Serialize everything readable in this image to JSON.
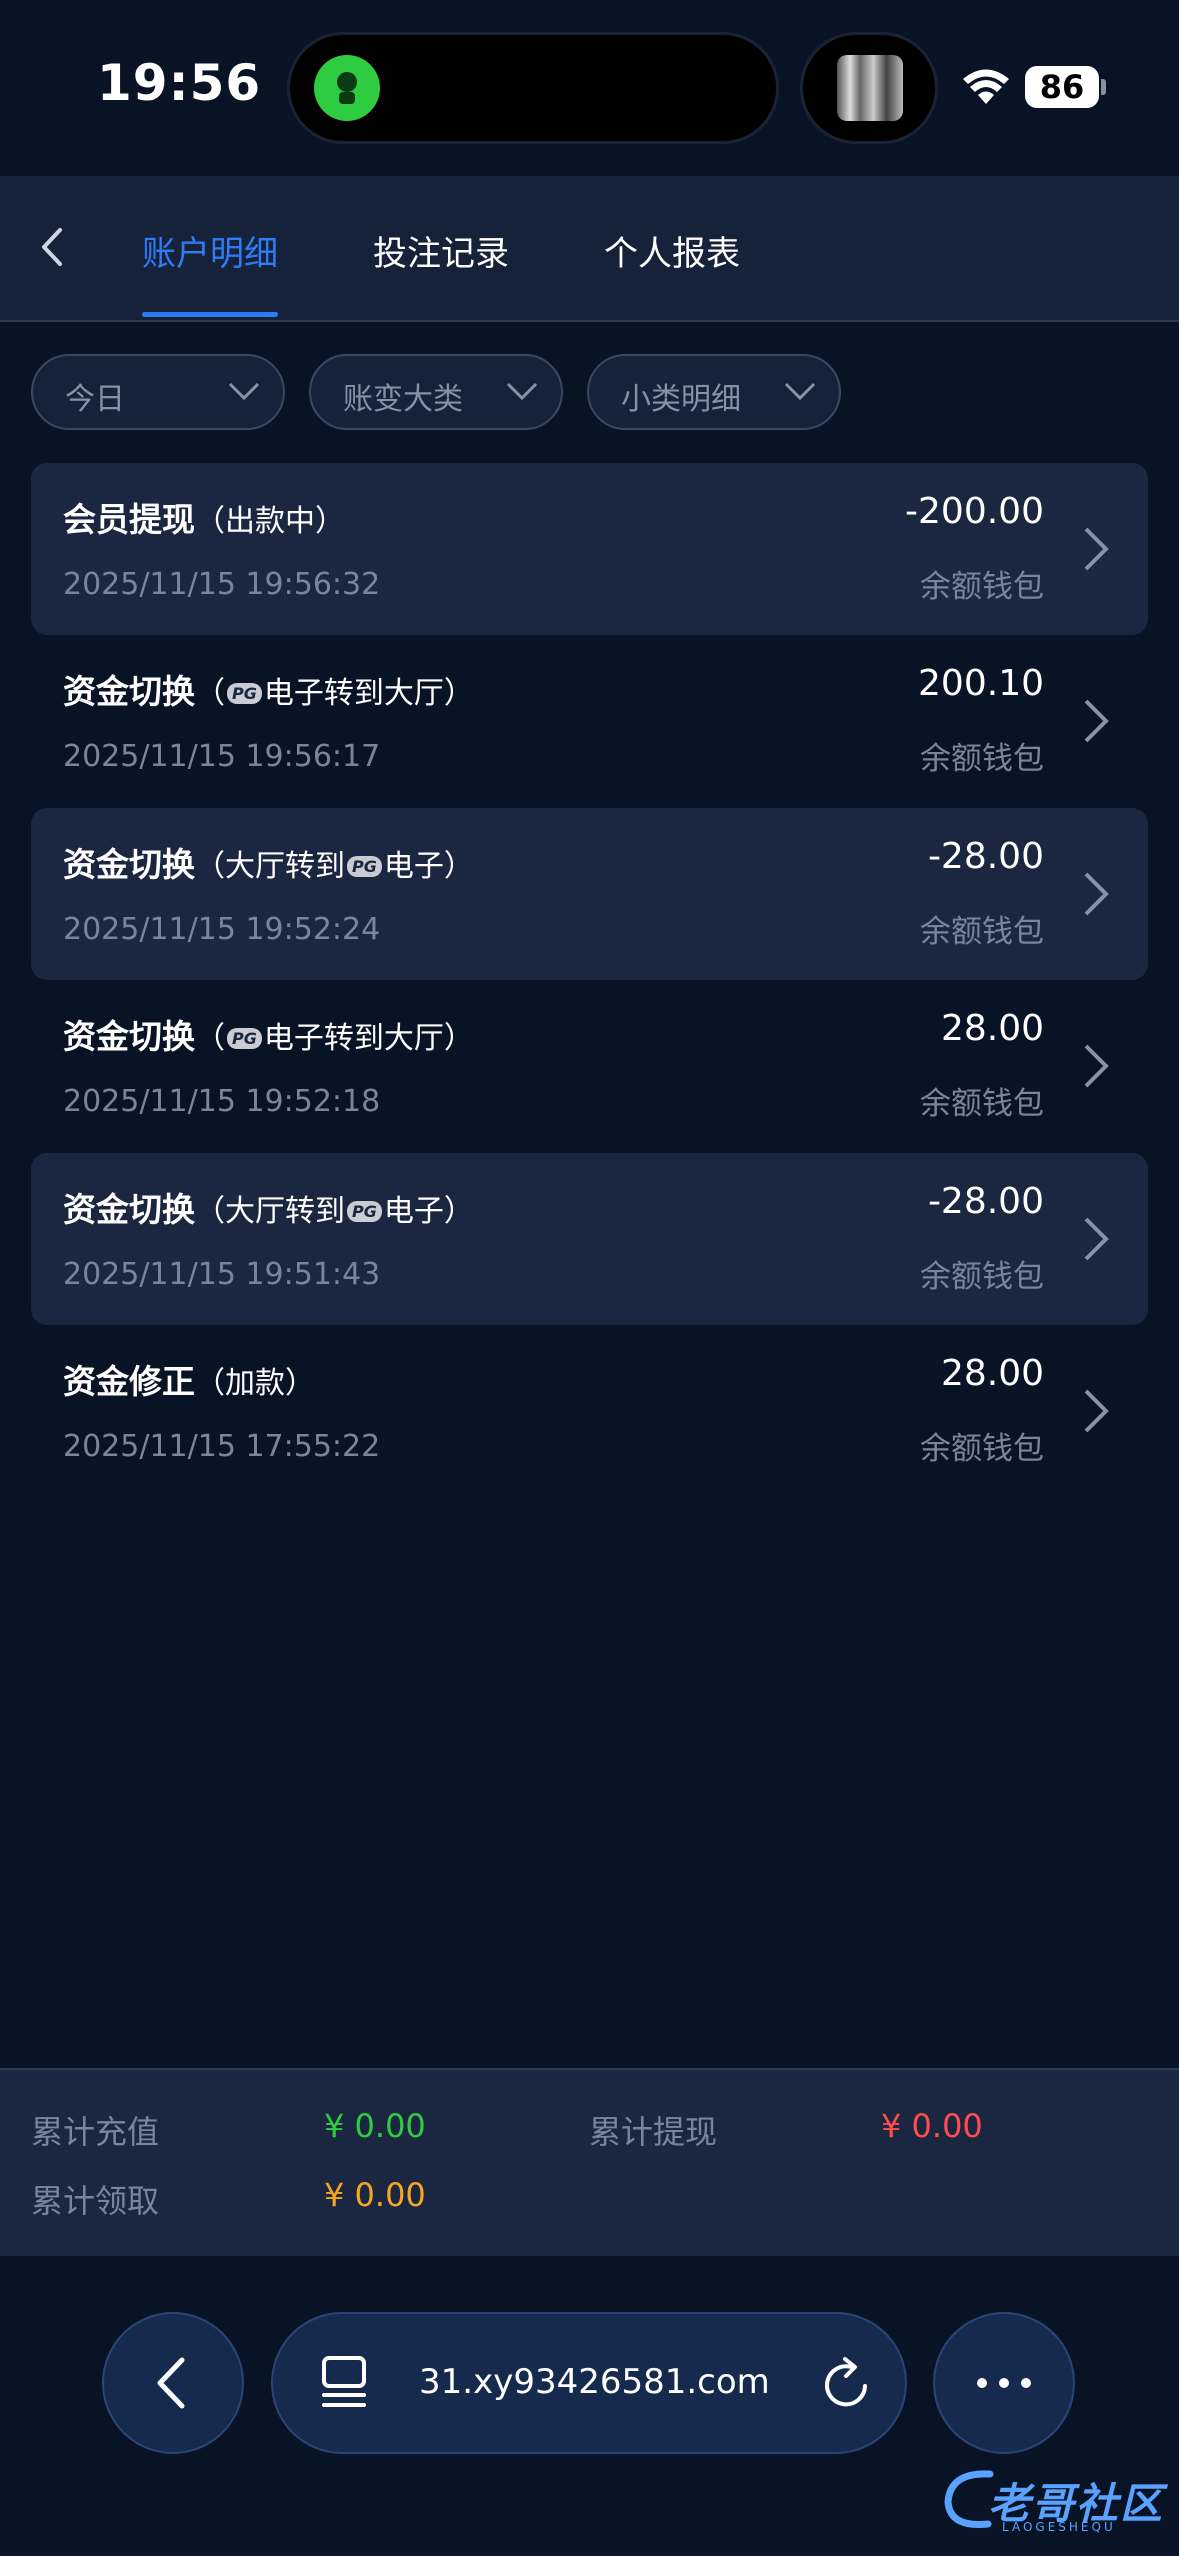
{
  "status": {
    "time": "19:56",
    "battery": "86"
  },
  "nav": {
    "tabs": [
      {
        "label": "账户明细",
        "active": true
      },
      {
        "label": "投注记录",
        "active": false
      },
      {
        "label": "个人报表",
        "active": false
      }
    ]
  },
  "filters": [
    {
      "label": "今日"
    },
    {
      "label": "账变大类"
    },
    {
      "label": "小类明细"
    }
  ],
  "records": [
    {
      "title": "会员提现",
      "parts": [
        "（出款中）"
      ],
      "time": "2025/11/15 19:56:32",
      "amount": "-200.00",
      "wallet": "余额钱包"
    },
    {
      "title": "资金切换",
      "parts": [
        "（",
        "PG",
        "电子转到大厅）"
      ],
      "time": "2025/11/15 19:56:17",
      "amount": "200.10",
      "wallet": "余额钱包"
    },
    {
      "title": "资金切换",
      "parts": [
        "（大厅转到",
        "PG",
        "电子）"
      ],
      "time": "2025/11/15 19:52:24",
      "amount": "-28.00",
      "wallet": "余额钱包"
    },
    {
      "title": "资金切换",
      "parts": [
        "（",
        "PG",
        "电子转到大厅）"
      ],
      "time": "2025/11/15 19:52:18",
      "amount": "28.00",
      "wallet": "余额钱包"
    },
    {
      "title": "资金切换",
      "parts": [
        "（大厅转到",
        "PG",
        "电子）"
      ],
      "time": "2025/11/15 19:51:43",
      "amount": "-28.00",
      "wallet": "余额钱包"
    },
    {
      "title": "资金修正",
      "parts": [
        "（加款）"
      ],
      "time": "2025/11/15 17:55:22",
      "amount": "28.00",
      "wallet": "余额钱包"
    }
  ],
  "summary": {
    "recharge_label": "累计充值",
    "recharge_value": "¥ 0.00",
    "withdraw_label": "累计提现",
    "withdraw_value": "¥ 0.00",
    "claim_label": "累计领取",
    "claim_value": "¥ 0.00"
  },
  "colors": {
    "accent": "#2d7cf6",
    "green": "#2ecc40",
    "red": "#ff4d4f",
    "orange": "#f5a623"
  },
  "browser": {
    "url": "31.xy93426581.com"
  },
  "watermark": {
    "text": "老哥社区",
    "sub": "LAOGESHEQU"
  }
}
